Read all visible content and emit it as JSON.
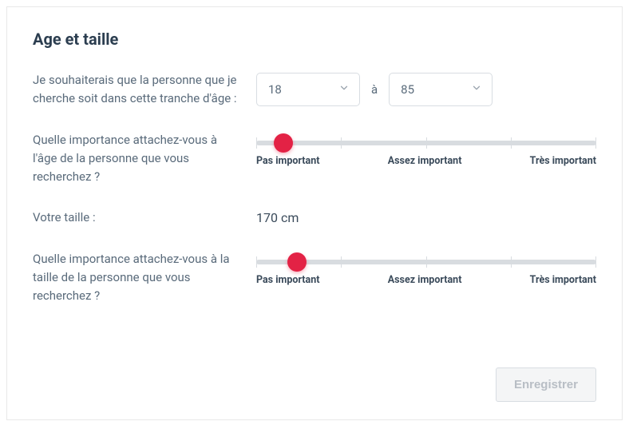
{
  "title": "Age et taille",
  "age": {
    "label": "Je souhaiterais que la personne que je cherche soit dans cette tranche d'âge :",
    "min": "18",
    "sep": "à",
    "max": "85"
  },
  "age_importance": {
    "label": "Quelle importance attachez-vous à l'âge de la personne que vous recherchez ?",
    "value_percent": 8,
    "scale": {
      "low": "Pas important",
      "mid": "Assez important",
      "high": "Très important"
    }
  },
  "height": {
    "label": "Votre taille :",
    "value": "170 cm"
  },
  "height_importance": {
    "label": "Quelle importance attachez-vous à la taille de la personne que vous recherchez ?",
    "value_percent": 12,
    "scale": {
      "low": "Pas important",
      "mid": "Assez important",
      "high": "Très important"
    }
  },
  "save_label": "Enregistrer",
  "colors": {
    "accent": "#e32245"
  }
}
